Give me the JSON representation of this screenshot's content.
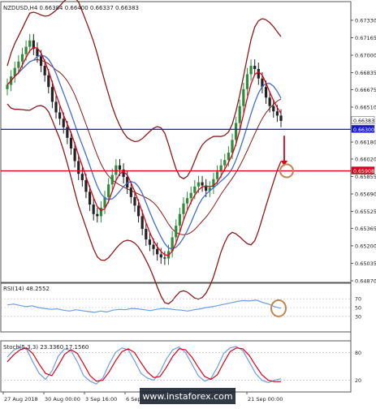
{
  "window": {
    "title": "NZDUSD,H4  0.66384 0.66400 0.66337 0.66383"
  },
  "colors": {
    "bullish": "#2e8b3a",
    "bearish": "#222222",
    "bollinger": "#8b1a1a",
    "ma_fast": "#e0001a",
    "ma_slow": "#3f6fd1",
    "support_line": "#1a1acc",
    "target_line": "#e0001a",
    "rsi": "#6a9ee0",
    "stoch_main": "#6a9ee0",
    "stoch_signal": "#e0001a",
    "price_tag_current": "#1a1acc",
    "price_tag_target": "#e0001a",
    "marker": "#c08550"
  },
  "chart_data": [
    {
      "id": "price",
      "type": "candlestick",
      "title": "NZDUSD,H4  0.66384 0.66400 0.66337 0.66383",
      "ylim": [
        0.6487,
        0.6746
      ],
      "y_ticks": [
        "0.67330",
        "0.67165",
        "0.67000",
        "0.66835",
        "0.66675",
        "0.66510",
        "0.66180",
        "0.66020",
        "0.65855",
        "0.65690",
        "0.65525",
        "0.65365",
        "0.65200",
        "0.65035",
        "0.64870"
      ],
      "price_tags": [
        {
          "label": "0.66383",
          "value": 0.66383,
          "kind": "current"
        },
        {
          "label": "0.66300",
          "value": 0.663,
          "kind": "level"
        },
        {
          "label": "0.65908",
          "value": 0.65908,
          "kind": "target"
        }
      ],
      "levels": [
        {
          "value": 0.663
        },
        {
          "value": 0.65908
        }
      ],
      "series_close": [
        0.6672,
        0.668,
        0.6688,
        0.6694,
        0.6701,
        0.6708,
        0.6714,
        0.6706,
        0.6699,
        0.669,
        0.6681,
        0.667,
        0.6656,
        0.6646,
        0.664,
        0.6632,
        0.6622,
        0.6612,
        0.66,
        0.6588,
        0.6582,
        0.6571,
        0.6559,
        0.655,
        0.6548,
        0.6556,
        0.6566,
        0.6578,
        0.6587,
        0.6596,
        0.6592,
        0.6585,
        0.6575,
        0.6566,
        0.6558,
        0.6548,
        0.6536,
        0.6526,
        0.6521,
        0.6517,
        0.6512,
        0.6509,
        0.6508,
        0.6515,
        0.6528,
        0.6539,
        0.655,
        0.656,
        0.6565,
        0.657,
        0.6576,
        0.658,
        0.6577,
        0.6572,
        0.6575,
        0.6583,
        0.659,
        0.6596,
        0.6601,
        0.6608,
        0.662,
        0.6636,
        0.6652,
        0.6668,
        0.6682,
        0.669,
        0.6687,
        0.6678,
        0.667,
        0.666,
        0.6652,
        0.6647,
        0.6643,
        0.6638
      ],
      "bands_upper_last": 0.67,
      "bands_lower_last": 0.663,
      "arrow": {
        "from": 0.6624,
        "to": 0.6595
      }
    },
    {
      "id": "rsi",
      "type": "line",
      "title": "RSI(14) 48.2552",
      "ylim": [
        0,
        100
      ],
      "levels": [
        30,
        50,
        70
      ],
      "series": [
        {
          "name": "RSI(14)",
          "values": [
            56,
            58,
            55,
            52,
            54,
            50,
            48,
            46,
            47,
            44,
            42,
            45,
            43,
            41,
            39,
            42,
            40,
            44,
            46,
            45,
            48,
            47,
            45,
            43,
            46,
            48,
            47,
            45,
            44,
            42,
            45,
            47,
            50,
            52,
            55,
            58,
            61,
            64,
            66,
            65,
            67,
            62,
            58,
            52,
            48.3
          ]
        }
      ]
    },
    {
      "id": "stoch",
      "type": "line",
      "title": "Stoch(5,3,3) 23.3360 17.1560",
      "ylim": [
        0,
        100
      ],
      "levels": [
        20,
        80
      ],
      "series": [
        {
          "name": "%K",
          "values": [
            70,
            85,
            92,
            88,
            60,
            35,
            22,
            40,
            72,
            88,
            84,
            60,
            30,
            18,
            12,
            25,
            55,
            80,
            90,
            86,
            62,
            35,
            25,
            20,
            38,
            66,
            86,
            92,
            80,
            55,
            30,
            18,
            24,
            48,
            78,
            90,
            93,
            84,
            60,
            35,
            20,
            15,
            20,
            23.3
          ]
        },
        {
          "name": "%D",
          "values": [
            60,
            75,
            86,
            90,
            78,
            55,
            35,
            30,
            52,
            76,
            86,
            78,
            55,
            30,
            18,
            20,
            38,
            62,
            82,
            88,
            80,
            58,
            38,
            26,
            28,
            48,
            72,
            88,
            86,
            70,
            48,
            28,
            22,
            32,
            58,
            82,
            90,
            88,
            74,
            52,
            32,
            20,
            17,
            17.2
          ]
        }
      ]
    }
  ],
  "xaxis": {
    "labels": [
      "27 Aug 2018",
      "30 Aug 00:00",
      "3 Sep 16:00",
      "6 Sep 08:00",
      "",
      "",
      "21 Sep 00:00"
    ]
  },
  "watermark": "www.instaforex.com"
}
